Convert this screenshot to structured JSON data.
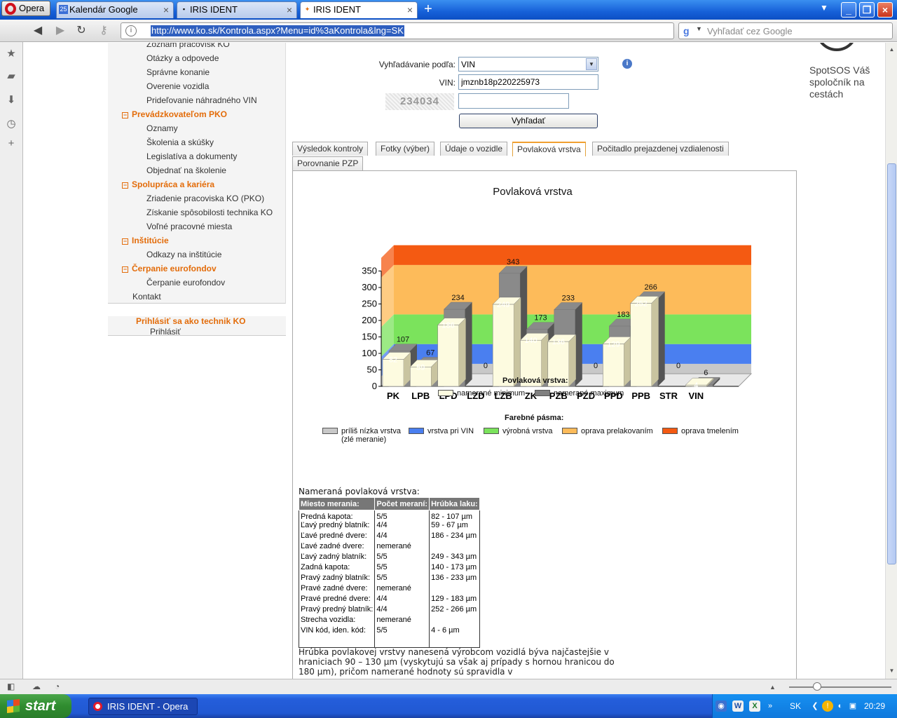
{
  "browser": {
    "menu_label": "Opera",
    "tabs": [
      {
        "label": "Kalendár Google",
        "icon": "25"
      },
      {
        "label": "IRIS IDENT"
      },
      {
        "label": "IRIS IDENT"
      }
    ],
    "url": "http://www.ko.sk/Kontrola.aspx?Menu=id%3aKontrola&lng=SK",
    "search_placeholder": "Vyhľadať cez Google"
  },
  "sidebar": {
    "items": [
      {
        "type": "item",
        "label": "Zoznam pracovísk KO"
      },
      {
        "type": "item",
        "label": "Otázky a odpovede"
      },
      {
        "type": "item",
        "label": "Správne konanie"
      },
      {
        "type": "item",
        "label": "Overenie vozidla"
      },
      {
        "type": "item",
        "label": "Prideľovanie náhradného VIN"
      },
      {
        "type": "header",
        "label": "Prevádzkovateľom PKO"
      },
      {
        "type": "item",
        "label": "Oznamy"
      },
      {
        "type": "item",
        "label": "Školenia a skúšky"
      },
      {
        "type": "item",
        "label": "Legislatíva a dokumenty"
      },
      {
        "type": "item",
        "label": "Objednať na školenie"
      },
      {
        "type": "header",
        "label": "Spolupráca a kariéra"
      },
      {
        "type": "item",
        "label": "Zriadenie pracoviska KO (PKO)"
      },
      {
        "type": "item",
        "label": "Získanie spôsobilosti technika KO"
      },
      {
        "type": "item",
        "label": "Voľné pracovné miesta"
      },
      {
        "type": "header",
        "label": "Inštitúcie"
      },
      {
        "type": "item",
        "label": "Odkazy na inštitúcie"
      },
      {
        "type": "header",
        "label": "Čerpanie eurofondov"
      },
      {
        "type": "item",
        "label": "Čerpanie eurofondov"
      },
      {
        "type": "top",
        "label": "Kontakt"
      }
    ],
    "login_title": "Prihlásiť sa ako technik KO",
    "login_link": "Prihlásiť"
  },
  "form": {
    "search_by_label": "Vyhľadávanie podľa:",
    "search_by_value": "VIN",
    "vin_label": "VIN:",
    "vin_value": "jmznb18p220225973",
    "captcha_text": "234034",
    "captcha_value": "",
    "search_button": "Vyhľadať"
  },
  "ad": {
    "text": "SpotSOS Váš spoločník na cestách"
  },
  "tabs": [
    {
      "label": "Výsledok kontroly",
      "active": false
    },
    {
      "label": "Fotky (výber)",
      "active": false
    },
    {
      "label": "Údaje o vozidle",
      "active": false
    },
    {
      "label": "Povlaková vrstva",
      "active": true
    },
    {
      "label": "Počitadlo prejazdenej vzdialenosti",
      "active": false
    },
    {
      "label": "Porovnanie PZP",
      "active": false
    }
  ],
  "chart_data": {
    "type": "bar",
    "title": "Povlaková vrstva",
    "categories": [
      "PK",
      "LPB",
      "LPD",
      "LZD",
      "LZB",
      "ZK",
      "PZB",
      "PZD",
      "PPD",
      "PPB",
      "STR",
      "VIN"
    ],
    "series": [
      {
        "name": "namerané minimum",
        "values": [
          82,
          59,
          186,
          0,
          249,
          140,
          136,
          0,
          129,
          252,
          0,
          4
        ],
        "color": "#fdfbe0"
      },
      {
        "name": "namerané maximum",
        "values": [
          107,
          67,
          234,
          0,
          343,
          173,
          233,
          0,
          183,
          266,
          0,
          6
        ],
        "color": "#808080"
      }
    ],
    "yticks": [
      0,
      50,
      100,
      150,
      200,
      250,
      300,
      350
    ],
    "ylim": [
      0,
      350
    ],
    "bands": [
      {
        "from": 0,
        "to": 30,
        "color": "#c8c8c8"
      },
      {
        "from": 30,
        "to": 90,
        "color": "#4a7ff0"
      },
      {
        "from": 90,
        "to": 180,
        "color": "#7be35c"
      },
      {
        "from": 180,
        "to": 330,
        "color": "#fdbb5a"
      },
      {
        "from": 330,
        "to": 390,
        "color": "#f45a12"
      }
    ],
    "legend_title": "Povlaková vrstva:",
    "bands_legend_title": "Farebné pásma:",
    "bands_legend": [
      {
        "label": "príliš nízka vrstva (zlé meranie)",
        "color": "#c8c8c8"
      },
      {
        "label": "vrstva pri VIN",
        "color": "#4a7ff0"
      },
      {
        "label": "výrobná vrstva",
        "color": "#7be35c"
      },
      {
        "label": "oprava prelakovaním",
        "color": "#fdbb5a"
      },
      {
        "label": "oprava tmelením",
        "color": "#f45a12"
      }
    ]
  },
  "measurements": {
    "title": "Nameraná povlaková vrstva:",
    "headers": [
      "Miesto merania:",
      "Počet meraní:",
      "Hrúbka laku:"
    ],
    "rows": [
      [
        "Predná kapota:",
        "5/5",
        "82 - 107 µm"
      ],
      [
        "Ľavý predný blatník:",
        "4/4",
        "59 - 67 µm"
      ],
      [
        "Ľavé predné dvere:",
        "4/4",
        "186 - 234 µm"
      ],
      [
        "Ľavé zadné dvere:",
        "nemerané",
        ""
      ],
      [
        "Ľavý zadný blatník:",
        "5/5",
        "249 - 343 µm"
      ],
      [
        "Zadná kapota:",
        "5/5",
        "140 - 173 µm"
      ],
      [
        "Pravý zadný blatník:",
        "5/5",
        "136 - 233 µm"
      ],
      [
        "Pravé zadné dvere:",
        "nemerané",
        ""
      ],
      [
        "Pravé predné dvere:",
        "4/4",
        "129 - 183 µm"
      ],
      [
        "Pravý predný blatník:",
        "4/4",
        "252 - 266 µm"
      ],
      [
        "Strecha vozidla:",
        "nemerané",
        ""
      ],
      [
        "VIN kód, iden. kód:",
        "5/5",
        "4 - 6 µm"
      ]
    ],
    "paragraph": "Hrúbka povlakovej vrstvy nanesená výrobcom vozidlá býva najčastejšie v hraniciach 90 – 130 µm (vyskytujú sa však aj prípady s hornou hranicou do 180 µm), pričom namerané hodnoty sú spravidla v"
  },
  "taskbar": {
    "start_label": "start",
    "window_label": "IRIS IDENT - Opera",
    "language": "SK",
    "clock": "20:29"
  }
}
